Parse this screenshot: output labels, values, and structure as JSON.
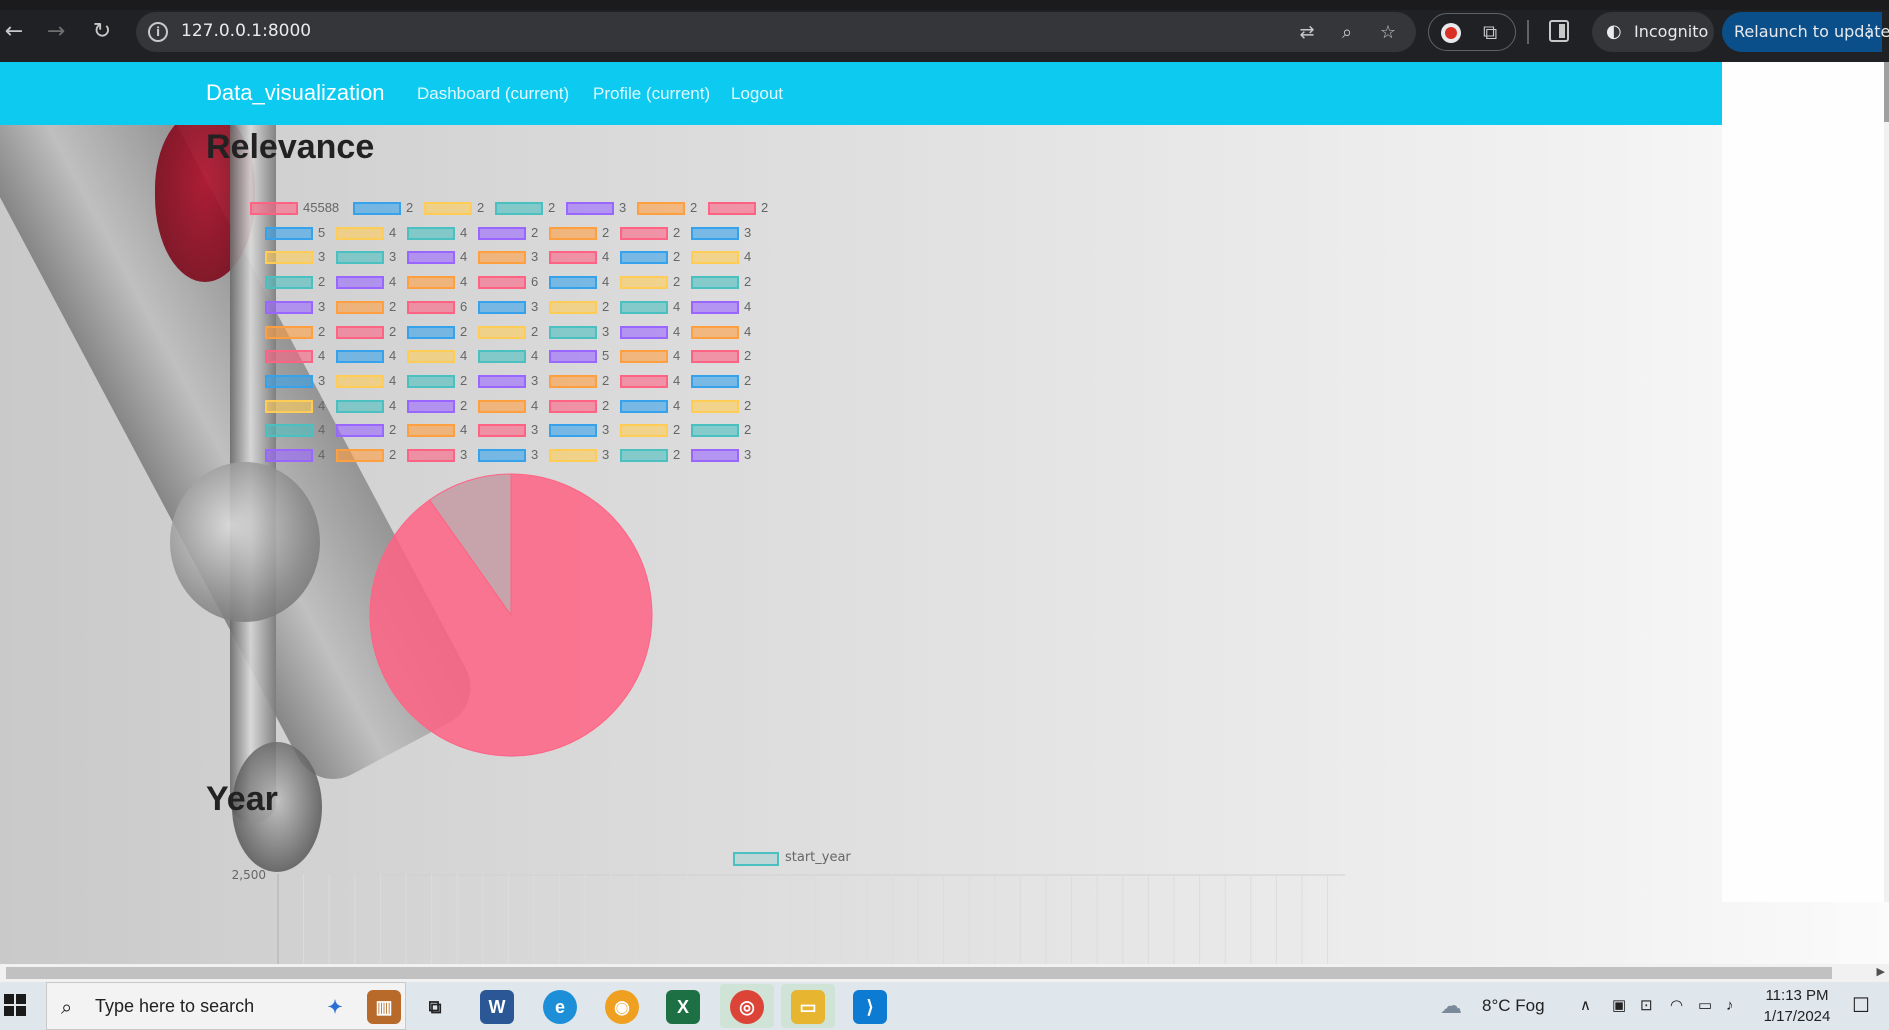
{
  "browser": {
    "url": "127.0.0.1:8000",
    "incognito_label": "Incognito",
    "relaunch_label": "Relaunch to update"
  },
  "navbar": {
    "brand": "Data_visualization",
    "links": [
      "Dashboard (current)",
      "Profile (current)",
      "Logout"
    ]
  },
  "relevance": {
    "title": "Relevance",
    "colors": [
      "#ff6384",
      "#36a2eb",
      "#ffcd56",
      "#4bc0c0",
      "#9966ff",
      "#ff9f40"
    ],
    "legend_rows": [
      [
        "45588",
        "2",
        "2",
        "2",
        "3",
        "2",
        "2"
      ],
      [
        "5",
        "4",
        "4",
        "2",
        "2",
        "2",
        "3"
      ],
      [
        "3",
        "3",
        "4",
        "3",
        "4",
        "2",
        "4"
      ],
      [
        "2",
        "4",
        "4",
        "6",
        "4",
        "2",
        "2"
      ],
      [
        "3",
        "2",
        "6",
        "3",
        "2",
        "4",
        "4"
      ],
      [
        "2",
        "2",
        "2",
        "2",
        "3",
        "4",
        "4"
      ],
      [
        "4",
        "4",
        "4",
        "4",
        "5",
        "4",
        "2"
      ],
      [
        "3",
        "4",
        "2",
        "3",
        "2",
        "4",
        "2"
      ],
      [
        "4",
        "4",
        "2",
        "4",
        "2",
        "4",
        "2"
      ],
      [
        "4",
        "2",
        "4",
        "3",
        "3",
        "2",
        "2"
      ],
      [
        "4",
        "2",
        "3",
        "3",
        "3",
        "2",
        "3"
      ]
    ]
  },
  "chart_data": [
    {
      "type": "pie",
      "title": "Relevance",
      "values": [
        45588,
        4962
      ],
      "colors": [
        "#ff6384",
        "#c49aa4"
      ]
    },
    {
      "type": "bar",
      "title": "Year",
      "series": [
        {
          "name": "start_year",
          "values": []
        }
      ],
      "ylim": [
        0,
        2500
      ],
      "yticks": [
        "2,500"
      ]
    }
  ],
  "year": {
    "title": "Year",
    "legend_label": "start_year",
    "ytick_top": "2,500"
  },
  "taskbar": {
    "search_placeholder": "Type here to search",
    "weather": "8°C  Fog",
    "time": "11:13 PM",
    "date": "1/17/2024"
  }
}
